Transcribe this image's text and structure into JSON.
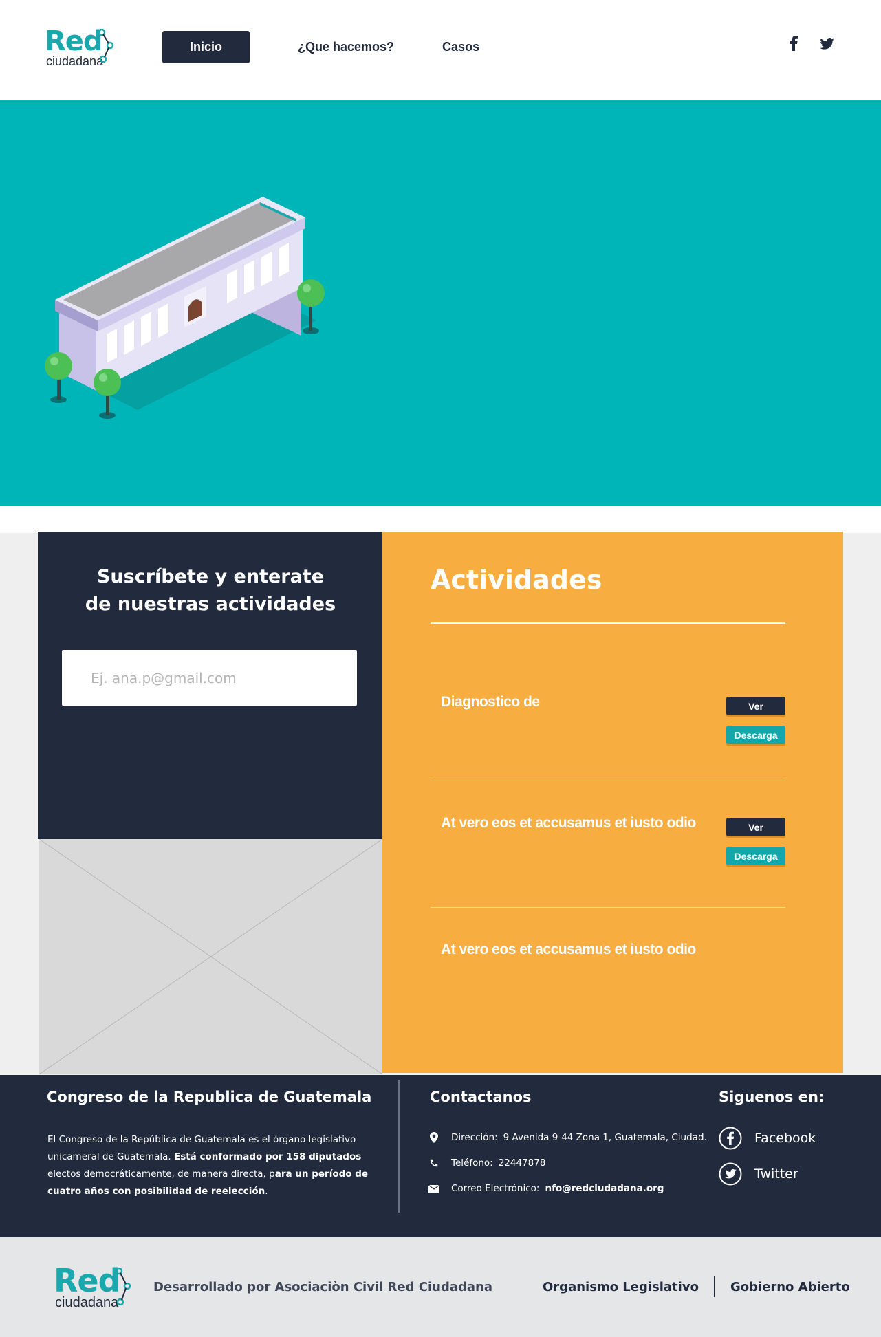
{
  "brand": {
    "logo_main": "Red",
    "logo_sub": "ciudadana",
    "colors": {
      "teal": "#00b5b8",
      "navy": "#222b3d",
      "orange": "#f8ad41"
    }
  },
  "nav": {
    "items": [
      {
        "label": "Inicio",
        "active": true
      },
      {
        "label": "¿Que hacemos?",
        "active": false
      },
      {
        "label": "Casos",
        "active": false
      }
    ],
    "social_icons": [
      "facebook-icon",
      "twitter-icon"
    ]
  },
  "hero": {
    "illustration": "building-illustration"
  },
  "subscribe": {
    "title_line1": "Suscríbete  y enterate",
    "title_line2": "de nuestras actividades",
    "email_placeholder": "Ej. ana.p@gmail.com"
  },
  "activities": {
    "title": "Actividades",
    "items": [
      {
        "title": "Diagnostico de",
        "view_label": "Ver",
        "download_label": "Descarga"
      },
      {
        "title": "At vero eos et accusamus et iusto odio",
        "view_label": "Ver",
        "download_label": "Descarga"
      },
      {
        "title": "At vero eos et accusamus et iusto odio"
      }
    ]
  },
  "footer": {
    "about": {
      "heading": "Congreso de la Republica de Guatemala",
      "p1": "El Congreso de la República de Guatemala es el órgano legislativo unicameral de Guatemala. ",
      "b1": "Está conformado por 158 diputados",
      "p2": " electos democráticamente, de manera directa, p",
      "b2": "ara un período de cuatro años con posibilidad de reelección",
      "p3": "."
    },
    "contact": {
      "heading": "Contactanos",
      "address_label": "Dirección:",
      "address": "9 Avenida 9-44 Zona 1, Guatemala, Ciudad.",
      "phone_label": "Teléfono:",
      "phone": "22447878",
      "email_label": "Correo Electrónico:",
      "email": "nfo@redciudadana.org"
    },
    "follow": {
      "heading": "Siguenos en:",
      "facebook": "Facebook",
      "twitter": "Twitter"
    }
  },
  "bottom": {
    "developed_by": "Desarrollado por Asociaciòn Civil Red Ciudadana",
    "link1": "Organismo Legislativo",
    "link2": "Gobierno Abierto"
  }
}
